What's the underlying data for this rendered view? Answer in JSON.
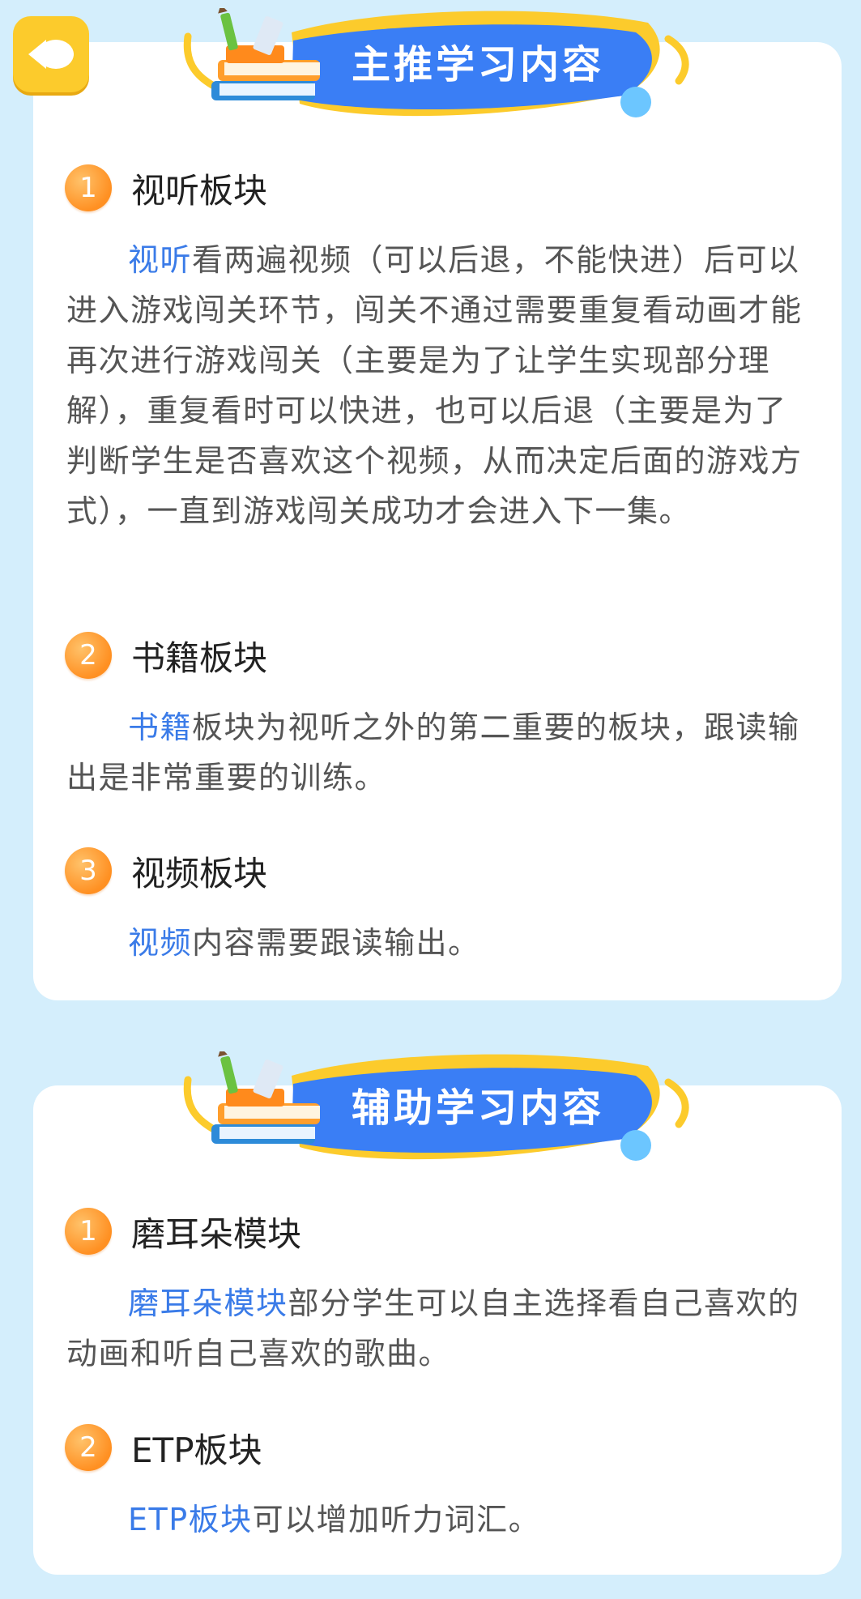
{
  "back_button": {
    "icon": "back-arrow-icon"
  },
  "main_section": {
    "title": "主推学习内容",
    "items": [
      {
        "number": "1",
        "title": "视听板块",
        "highlight": "视听",
        "text": "看两遍视频（可以后退，不能快进）后可以进入游戏闯关环节，闯关不通过需要重复看动画才能再次进行游戏闯关（主要是为了让学生实现部分理解），重复看时可以快进，也可以后退（主要是为了判断学生是否喜欢这个视频，从而决定后面的游戏方式），一直到游戏闯关成功才会进入下一集。"
      },
      {
        "number": "2",
        "title": "书籍板块",
        "highlight": "书籍",
        "text": "板块为视听之外的第二重要的板块，跟读输出是非常重要的训练。"
      },
      {
        "number": "3",
        "title": "视频板块",
        "highlight": "视频",
        "text": "内容需要跟读输出。"
      }
    ]
  },
  "aux_section": {
    "title": "辅助学习内容",
    "items": [
      {
        "number": "1",
        "title": "磨耳朵模块",
        "highlight": "磨耳朵模块",
        "text": "部分学生可以自主选择看自己喜欢的动画和听自己喜欢的歌曲。"
      },
      {
        "number": "2",
        "title": "ETP板块",
        "highlight": "ETP板块",
        "text": "可以增加听力词汇。"
      }
    ]
  },
  "colors": {
    "background": "#d4eefc",
    "ribbon": "#3a7ef5",
    "highlight": "#3a7be8",
    "badge": "#ff9022",
    "accent_yellow": "#fccb2c"
  }
}
